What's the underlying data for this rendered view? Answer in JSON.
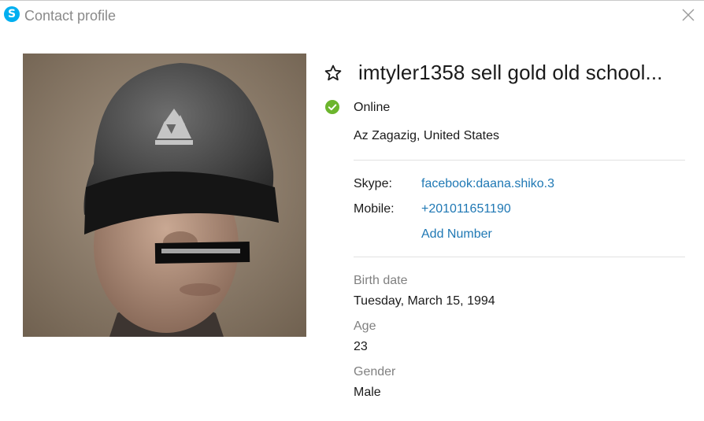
{
  "window": {
    "title": "Contact profile",
    "logo_icon": "skype-logo-icon",
    "logo_letter": "S",
    "close_icon": "close-icon"
  },
  "profile": {
    "display_name": "imtyler1358  sell gold old school...",
    "favorite_icon": "star-outline-icon",
    "status": "Online",
    "status_icon": "online-check-icon",
    "status_color": "#6cb52d",
    "location": "Az Zagazig, United States"
  },
  "contact": {
    "skype_label": "Skype:",
    "skype_value": "facebook:daana.shiko.3",
    "mobile_label": "Mobile:",
    "mobile_value": "+201011651190",
    "add_number_label": "Add Number",
    "link_color": "#1f78b4"
  },
  "details": {
    "birth_date_label": "Birth date",
    "birth_date_value": "Tuesday, March 15, 1994",
    "age_label": "Age",
    "age_value": "23",
    "gender_label": "Gender",
    "gender_value": "Male"
  }
}
